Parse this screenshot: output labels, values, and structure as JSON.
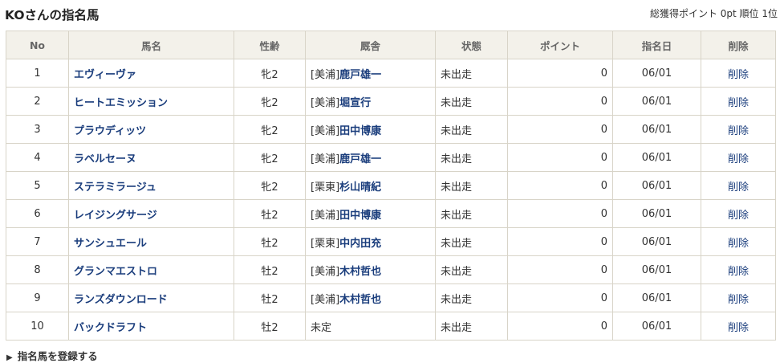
{
  "page": {
    "title": "KOさんの指名馬",
    "summary": "総獲得ポイント 0pt 順位 1位"
  },
  "table": {
    "headers": [
      "No",
      "馬名",
      "性齢",
      "厩舎",
      "状態",
      "ポイント",
      "指名日",
      "削除"
    ],
    "rows": [
      {
        "no": "1",
        "name": "エヴィーヴァ",
        "sex_age": "牝2",
        "region": "[美浦]",
        "trainer": "鹿戸雄一",
        "status": "未出走",
        "points": "0",
        "date": "06/01",
        "delete": "削除"
      },
      {
        "no": "2",
        "name": "ヒートエミッション",
        "sex_age": "牝2",
        "region": "[美浦]",
        "trainer": "堀宣行",
        "status": "未出走",
        "points": "0",
        "date": "06/01",
        "delete": "削除"
      },
      {
        "no": "3",
        "name": "プラウディッツ",
        "sex_age": "牝2",
        "region": "[美浦]",
        "trainer": "田中博康",
        "status": "未出走",
        "points": "0",
        "date": "06/01",
        "delete": "削除"
      },
      {
        "no": "4",
        "name": "ラベルセーヌ",
        "sex_age": "牝2",
        "region": "[美浦]",
        "trainer": "鹿戸雄一",
        "status": "未出走",
        "points": "0",
        "date": "06/01",
        "delete": "削除"
      },
      {
        "no": "5",
        "name": "ステラミラージュ",
        "sex_age": "牝2",
        "region": "[栗東]",
        "trainer": "杉山晴紀",
        "status": "未出走",
        "points": "0",
        "date": "06/01",
        "delete": "削除"
      },
      {
        "no": "6",
        "name": "レイジングサージ",
        "sex_age": "牡2",
        "region": "[美浦]",
        "trainer": "田中博康",
        "status": "未出走",
        "points": "0",
        "date": "06/01",
        "delete": "削除"
      },
      {
        "no": "7",
        "name": "サンシュエール",
        "sex_age": "牡2",
        "region": "[栗東]",
        "trainer": "中内田充",
        "status": "未出走",
        "points": "0",
        "date": "06/01",
        "delete": "削除"
      },
      {
        "no": "8",
        "name": "グランマエストロ",
        "sex_age": "牡2",
        "region": "[美浦]",
        "trainer": "木村哲也",
        "status": "未出走",
        "points": "0",
        "date": "06/01",
        "delete": "削除"
      },
      {
        "no": "9",
        "name": "ランズダウンロード",
        "sex_age": "牡2",
        "region": "[美浦]",
        "trainer": "木村哲也",
        "status": "未出走",
        "points": "0",
        "date": "06/01",
        "delete": "削除"
      },
      {
        "no": "10",
        "name": "バックドラフト",
        "sex_age": "牡2",
        "region": "未定",
        "trainer": "",
        "status": "未出走",
        "points": "0",
        "date": "06/01",
        "delete": "削除"
      }
    ]
  },
  "footer": {
    "register_link": "指名馬を登録する",
    "arrow_icon": "triangle-right-icon"
  }
}
